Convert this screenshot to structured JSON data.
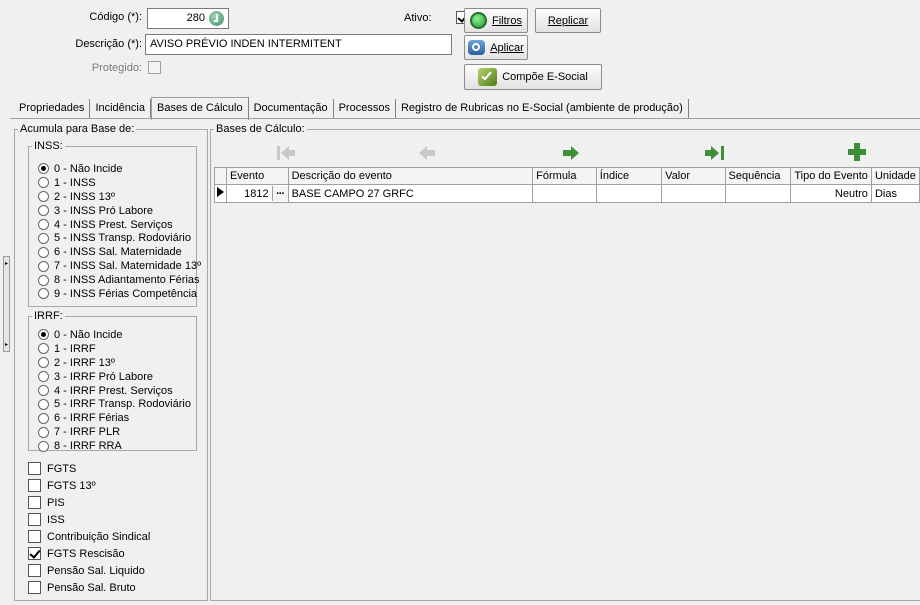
{
  "header": {
    "codigo_label": "Código (*):",
    "codigo_value": "280",
    "descricao_label": "Descrição (*):",
    "descricao_value": "AVISO PRÉVIO INDEN INTERMITENT",
    "protegido_label": "Protegido:",
    "ativo_label": "Ativo:",
    "ativo_checked": true
  },
  "buttons": {
    "filtros": "Filtros",
    "replicar": "Replicar",
    "aplicar": "Aplicar",
    "compoe": "Compõe E-Social"
  },
  "tabs": [
    {
      "label": "Propriedades"
    },
    {
      "label": "Incidência"
    },
    {
      "label": "Bases de Cálculo",
      "active": true
    },
    {
      "label": "Documentação"
    },
    {
      "label": "Processos"
    },
    {
      "label": "Registro de Rubricas no E-Social (ambiente de produção)"
    }
  ],
  "acumula": {
    "title": "Acumula para Base de:",
    "inss_title": "INSS:",
    "inss_options": [
      "0 - Não Incide",
      "1 - INSS",
      "2 - INSS 13º",
      "3 - INSS Pró Labore",
      "4 - INSS Prest. Serviços",
      "5 - INSS Transp. Rodoviário",
      "6 - INSS Sal. Maternidade",
      "7 - INSS Sal. Maternidade 13º",
      "8 - INSS Adiantamento Férias",
      "9 - INSS Férias Competência"
    ],
    "inss_selected": 0,
    "irrf_title": "IRRF:",
    "irrf_options": [
      "0 - Não Incide",
      "1 - IRRF",
      "2 - IRRF 13º",
      "3 - IRRF Pró Labore",
      "4 - IRRF Prest. Serviços",
      "5 - IRRF Transp. Rodoviário",
      "6 - IRRF Férias",
      "7 - IRRF PLR",
      "8 - IRRF RRA"
    ],
    "irrf_selected": 0,
    "checkboxes": [
      {
        "label": "FGTS",
        "checked": false
      },
      {
        "label": "FGTS 13º",
        "checked": false
      },
      {
        "label": "PIS",
        "checked": false
      },
      {
        "label": "ISS",
        "checked": false
      },
      {
        "label": "Contribuição Sindical",
        "checked": false
      },
      {
        "label": "FGTS Rescisão",
        "checked": true
      },
      {
        "label": "Pensão Sal. Liquido",
        "checked": false
      },
      {
        "label": "Pensão Sal. Bruto",
        "checked": false
      }
    ]
  },
  "bases": {
    "title": "Bases de Cálculo:",
    "toolbar_icons": [
      "first-arrow-icon",
      "left-arrow-icon",
      "right-arrow-icon",
      "last-arrow-icon",
      "plus-icon"
    ],
    "columns": [
      "Evento",
      "Descrição do evento",
      "Fórmula",
      "Índice",
      "Valor",
      "Sequência",
      "Tipo do Evento",
      "Unidade"
    ],
    "rows": [
      {
        "evento": "1812",
        "descricao": "BASE CAMPO 27 GRFC",
        "formula": "",
        "indice": "",
        "valor": "",
        "sequencia": "",
        "tipo": "Neutro",
        "unidade": "Dias"
      }
    ]
  }
}
